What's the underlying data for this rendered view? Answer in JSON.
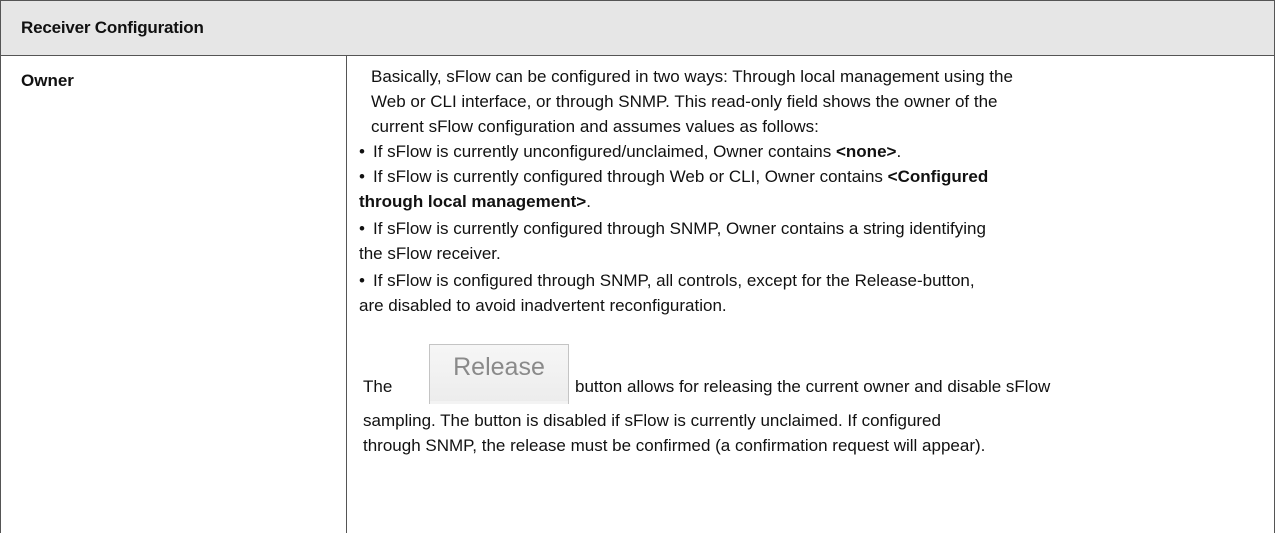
{
  "header": {
    "title": "Receiver Configuration"
  },
  "row": {
    "term": "Owner",
    "intro_lines": [
      "Basically, sFlow can be configured in two ways: Through local management using the",
      "Web or CLI interface, or through SNMP. This read-only field shows the owner of the",
      "current sFlow configuration and assumes values as follows:"
    ],
    "bullet_char": "•",
    "bullet1_text": "If sFlow is currently unconfigured/unclaimed, Owner contains ",
    "bullet1_bold": "<none>",
    "bullet1_end": ".",
    "bullet2_text": "If sFlow is currently configured through Web or CLI, Owner contains ",
    "bullet2_bold_a": "<Configured",
    "bullet2_bold_b": "through local management>",
    "bullet2_end": ".",
    "bullet3_line1": "If sFlow is currently configured through SNMP, Owner contains a string identifying",
    "bullet3_line2": "the sFlow receiver.",
    "bullet4_line1": "If sFlow is configured through SNMP, all controls, except for the Release-button,",
    "bullet4_line2": "are disabled to avoid inadvertent reconfiguration.",
    "release_prefix": "The",
    "release_button_label": "Release",
    "release_suffix": "button allows for releasing the current owner and disable sFlow",
    "release_line2": "sampling. The button is disabled if sFlow is currently unclaimed. If configured",
    "release_line3": "through SNMP, the release must be confirmed (a confirmation request will appear)."
  }
}
